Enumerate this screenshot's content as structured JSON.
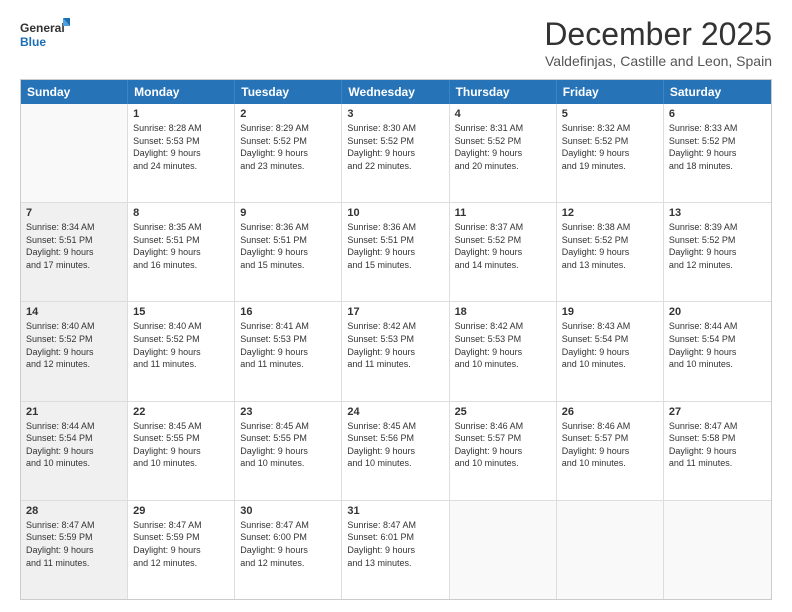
{
  "logo": {
    "general": "General",
    "blue": "Blue"
  },
  "title": "December 2025",
  "location": "Valdefinjas, Castille and Leon, Spain",
  "days_header": [
    "Sunday",
    "Monday",
    "Tuesday",
    "Wednesday",
    "Thursday",
    "Friday",
    "Saturday"
  ],
  "rows": [
    [
      {
        "day": "",
        "lines": [],
        "empty": true
      },
      {
        "day": "1",
        "lines": [
          "Sunrise: 8:28 AM",
          "Sunset: 5:53 PM",
          "Daylight: 9 hours",
          "and 24 minutes."
        ]
      },
      {
        "day": "2",
        "lines": [
          "Sunrise: 8:29 AM",
          "Sunset: 5:52 PM",
          "Daylight: 9 hours",
          "and 23 minutes."
        ]
      },
      {
        "day": "3",
        "lines": [
          "Sunrise: 8:30 AM",
          "Sunset: 5:52 PM",
          "Daylight: 9 hours",
          "and 22 minutes."
        ]
      },
      {
        "day": "4",
        "lines": [
          "Sunrise: 8:31 AM",
          "Sunset: 5:52 PM",
          "Daylight: 9 hours",
          "and 20 minutes."
        ]
      },
      {
        "day": "5",
        "lines": [
          "Sunrise: 8:32 AM",
          "Sunset: 5:52 PM",
          "Daylight: 9 hours",
          "and 19 minutes."
        ]
      },
      {
        "day": "6",
        "lines": [
          "Sunrise: 8:33 AM",
          "Sunset: 5:52 PM",
          "Daylight: 9 hours",
          "and 18 minutes."
        ]
      }
    ],
    [
      {
        "day": "7",
        "lines": [
          "Sunrise: 8:34 AM",
          "Sunset: 5:51 PM",
          "Daylight: 9 hours",
          "and 17 minutes."
        ],
        "shaded": true
      },
      {
        "day": "8",
        "lines": [
          "Sunrise: 8:35 AM",
          "Sunset: 5:51 PM",
          "Daylight: 9 hours",
          "and 16 minutes."
        ]
      },
      {
        "day": "9",
        "lines": [
          "Sunrise: 8:36 AM",
          "Sunset: 5:51 PM",
          "Daylight: 9 hours",
          "and 15 minutes."
        ]
      },
      {
        "day": "10",
        "lines": [
          "Sunrise: 8:36 AM",
          "Sunset: 5:51 PM",
          "Daylight: 9 hours",
          "and 15 minutes."
        ]
      },
      {
        "day": "11",
        "lines": [
          "Sunrise: 8:37 AM",
          "Sunset: 5:52 PM",
          "Daylight: 9 hours",
          "and 14 minutes."
        ]
      },
      {
        "day": "12",
        "lines": [
          "Sunrise: 8:38 AM",
          "Sunset: 5:52 PM",
          "Daylight: 9 hours",
          "and 13 minutes."
        ]
      },
      {
        "day": "13",
        "lines": [
          "Sunrise: 8:39 AM",
          "Sunset: 5:52 PM",
          "Daylight: 9 hours",
          "and 12 minutes."
        ]
      }
    ],
    [
      {
        "day": "14",
        "lines": [
          "Sunrise: 8:40 AM",
          "Sunset: 5:52 PM",
          "Daylight: 9 hours",
          "and 12 minutes."
        ],
        "shaded": true
      },
      {
        "day": "15",
        "lines": [
          "Sunrise: 8:40 AM",
          "Sunset: 5:52 PM",
          "Daylight: 9 hours",
          "and 11 minutes."
        ]
      },
      {
        "day": "16",
        "lines": [
          "Sunrise: 8:41 AM",
          "Sunset: 5:53 PM",
          "Daylight: 9 hours",
          "and 11 minutes."
        ]
      },
      {
        "day": "17",
        "lines": [
          "Sunrise: 8:42 AM",
          "Sunset: 5:53 PM",
          "Daylight: 9 hours",
          "and 11 minutes."
        ]
      },
      {
        "day": "18",
        "lines": [
          "Sunrise: 8:42 AM",
          "Sunset: 5:53 PM",
          "Daylight: 9 hours",
          "and 10 minutes."
        ]
      },
      {
        "day": "19",
        "lines": [
          "Sunrise: 8:43 AM",
          "Sunset: 5:54 PM",
          "Daylight: 9 hours",
          "and 10 minutes."
        ]
      },
      {
        "day": "20",
        "lines": [
          "Sunrise: 8:44 AM",
          "Sunset: 5:54 PM",
          "Daylight: 9 hours",
          "and 10 minutes."
        ]
      }
    ],
    [
      {
        "day": "21",
        "lines": [
          "Sunrise: 8:44 AM",
          "Sunset: 5:54 PM",
          "Daylight: 9 hours",
          "and 10 minutes."
        ],
        "shaded": true
      },
      {
        "day": "22",
        "lines": [
          "Sunrise: 8:45 AM",
          "Sunset: 5:55 PM",
          "Daylight: 9 hours",
          "and 10 minutes."
        ]
      },
      {
        "day": "23",
        "lines": [
          "Sunrise: 8:45 AM",
          "Sunset: 5:55 PM",
          "Daylight: 9 hours",
          "and 10 minutes."
        ]
      },
      {
        "day": "24",
        "lines": [
          "Sunrise: 8:45 AM",
          "Sunset: 5:56 PM",
          "Daylight: 9 hours",
          "and 10 minutes."
        ]
      },
      {
        "day": "25",
        "lines": [
          "Sunrise: 8:46 AM",
          "Sunset: 5:57 PM",
          "Daylight: 9 hours",
          "and 10 minutes."
        ]
      },
      {
        "day": "26",
        "lines": [
          "Sunrise: 8:46 AM",
          "Sunset: 5:57 PM",
          "Daylight: 9 hours",
          "and 10 minutes."
        ]
      },
      {
        "day": "27",
        "lines": [
          "Sunrise: 8:47 AM",
          "Sunset: 5:58 PM",
          "Daylight: 9 hours",
          "and 11 minutes."
        ]
      }
    ],
    [
      {
        "day": "28",
        "lines": [
          "Sunrise: 8:47 AM",
          "Sunset: 5:59 PM",
          "Daylight: 9 hours",
          "and 11 minutes."
        ],
        "shaded": true
      },
      {
        "day": "29",
        "lines": [
          "Sunrise: 8:47 AM",
          "Sunset: 5:59 PM",
          "Daylight: 9 hours",
          "and 12 minutes."
        ]
      },
      {
        "day": "30",
        "lines": [
          "Sunrise: 8:47 AM",
          "Sunset: 6:00 PM",
          "Daylight: 9 hours",
          "and 12 minutes."
        ]
      },
      {
        "day": "31",
        "lines": [
          "Sunrise: 8:47 AM",
          "Sunset: 6:01 PM",
          "Daylight: 9 hours",
          "and 13 minutes."
        ]
      },
      {
        "day": "",
        "lines": [],
        "empty": true
      },
      {
        "day": "",
        "lines": [],
        "empty": true
      },
      {
        "day": "",
        "lines": [],
        "empty": true
      }
    ]
  ]
}
